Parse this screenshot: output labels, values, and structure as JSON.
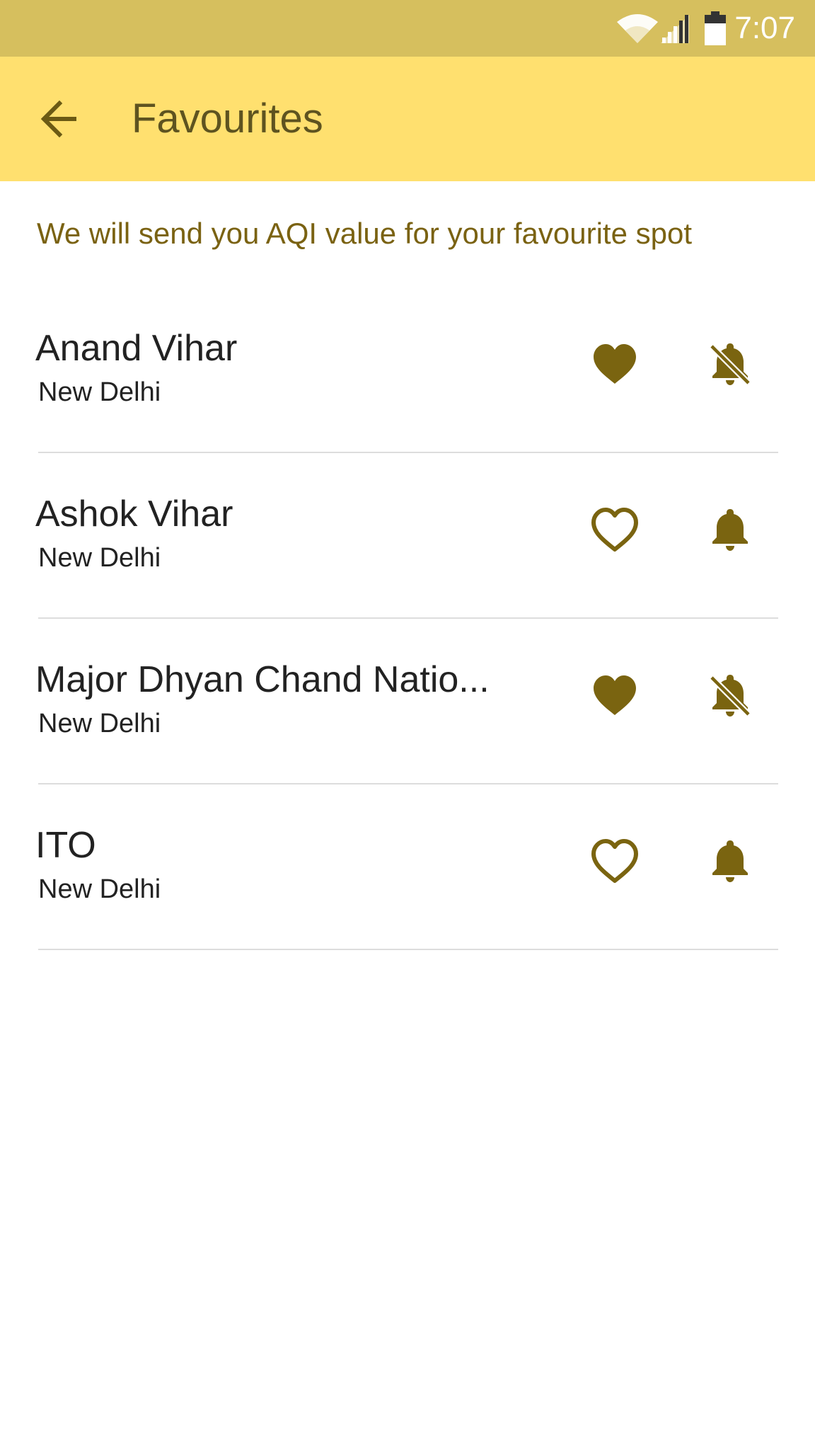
{
  "status_bar": {
    "time": "7:07",
    "icons": [
      "wifi-icon",
      "signal-icon",
      "battery-icon"
    ]
  },
  "app_bar": {
    "title": "Favourites",
    "back_icon": "arrow-left-icon"
  },
  "info": {
    "text": "We will send you AQI value for your favourite spot"
  },
  "favourites": [
    {
      "name": "Anand Vihar",
      "city": "New Delhi",
      "favourite": true,
      "notifications": false
    },
    {
      "name": "Ashok Vihar",
      "city": "New Delhi",
      "favourite": false,
      "notifications": true
    },
    {
      "name": "Major Dhyan Chand Natio...",
      "city": "New Delhi",
      "favourite": true,
      "notifications": false
    },
    {
      "name": "ITO",
      "city": "New Delhi",
      "favourite": false,
      "notifications": true
    }
  ],
  "colors": {
    "status_bar": "#d6bf5e",
    "app_bar": "#ffe06f",
    "accent": "#7a6212",
    "icon": "#7a6410",
    "text": "#222222",
    "divider": "#dddddd"
  }
}
